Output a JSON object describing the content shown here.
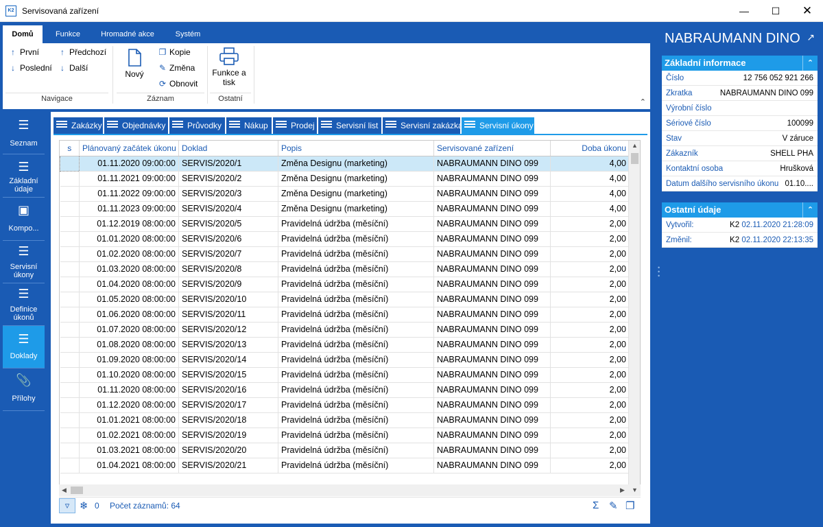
{
  "window": {
    "title": "Servisovaná zařízení",
    "icon_text": "K2"
  },
  "ribbon": {
    "tabs": [
      "Domů",
      "Funkce",
      "Hromadné akce",
      "Systém"
    ],
    "navigace": {
      "label": "Navigace",
      "prvni": "První",
      "predchozi": "Předchozí",
      "posledni": "Poslední",
      "dalsi": "Další"
    },
    "zaznam": {
      "label": "Záznam",
      "novy": "Nový",
      "kopie": "Kopie",
      "zmena": "Změna",
      "obnovit": "Obnovit"
    },
    "ostatni": {
      "label": "Ostatní",
      "funkce_line1": "Funkce a",
      "funkce_line2": "tisk"
    }
  },
  "leftnav": [
    {
      "label": "Seznam",
      "icon": "list-icon"
    },
    {
      "label": "Základní údaje",
      "icon": "details-list-icon"
    },
    {
      "label": "Kompo...",
      "icon": "box-icon"
    },
    {
      "label": "Servisní úkony",
      "icon": "list-icon"
    },
    {
      "label": "Definice úkonů",
      "icon": "list-icon"
    },
    {
      "label": "Doklady",
      "icon": "list-icon"
    },
    {
      "label": "Přílohy",
      "icon": "paperclip-icon"
    }
  ],
  "doc_tabs": [
    "Zakázky",
    "Objednávky",
    "Průvodky",
    "Nákup",
    "Prodej",
    "Servisní list",
    "Servisní zakázka",
    "Servisní úkony"
  ],
  "table": {
    "columns": [
      "s",
      "Plánovaný začátek úkonu",
      "Doklad",
      "Popis",
      "Servisované zařízení",
      "Doba úkonu"
    ],
    "rows": [
      [
        "",
        "01.11.2020 09:00:00",
        "SERVIS/2020/1",
        "Změna Designu (marketing)",
        "NABRAUMANN DINO 099",
        "4,00"
      ],
      [
        "",
        "01.11.2021 09:00:00",
        "SERVIS/2020/2",
        "Změna Designu (marketing)",
        "NABRAUMANN DINO 099",
        "4,00"
      ],
      [
        "",
        "01.11.2022 09:00:00",
        "SERVIS/2020/3",
        "Změna Designu (marketing)",
        "NABRAUMANN DINO 099",
        "4,00"
      ],
      [
        "",
        "01.11.2023 09:00:00",
        "SERVIS/2020/4",
        "Změna Designu (marketing)",
        "NABRAUMANN DINO 099",
        "4,00"
      ],
      [
        "",
        "01.12.2019 08:00:00",
        "SERVIS/2020/5",
        "Pravidelná údržba (měsíční)",
        "NABRAUMANN DINO 099",
        "2,00"
      ],
      [
        "",
        "01.01.2020 08:00:00",
        "SERVIS/2020/6",
        "Pravidelná údržba (měsíční)",
        "NABRAUMANN DINO 099",
        "2,00"
      ],
      [
        "",
        "01.02.2020 08:00:00",
        "SERVIS/2020/7",
        "Pravidelná údržba (měsíční)",
        "NABRAUMANN DINO 099",
        "2,00"
      ],
      [
        "",
        "01.03.2020 08:00:00",
        "SERVIS/2020/8",
        "Pravidelná údržba (měsíční)",
        "NABRAUMANN DINO 099",
        "2,00"
      ],
      [
        "",
        "01.04.2020 08:00:00",
        "SERVIS/2020/9",
        "Pravidelná údržba (měsíční)",
        "NABRAUMANN DINO 099",
        "2,00"
      ],
      [
        "",
        "01.05.2020 08:00:00",
        "SERVIS/2020/10",
        "Pravidelná údržba (měsíční)",
        "NABRAUMANN DINO 099",
        "2,00"
      ],
      [
        "",
        "01.06.2020 08:00:00",
        "SERVIS/2020/11",
        "Pravidelná údržba (měsíční)",
        "NABRAUMANN DINO 099",
        "2,00"
      ],
      [
        "",
        "01.07.2020 08:00:00",
        "SERVIS/2020/12",
        "Pravidelná údržba (měsíční)",
        "NABRAUMANN DINO 099",
        "2,00"
      ],
      [
        "",
        "01.08.2020 08:00:00",
        "SERVIS/2020/13",
        "Pravidelná údržba (měsíční)",
        "NABRAUMANN DINO 099",
        "2,00"
      ],
      [
        "",
        "01.09.2020 08:00:00",
        "SERVIS/2020/14",
        "Pravidelná údržba (měsíční)",
        "NABRAUMANN DINO 099",
        "2,00"
      ],
      [
        "",
        "01.10.2020 08:00:00",
        "SERVIS/2020/15",
        "Pravidelná údržba (měsíční)",
        "NABRAUMANN DINO 099",
        "2,00"
      ],
      [
        "",
        "01.11.2020 08:00:00",
        "SERVIS/2020/16",
        "Pravidelná údržba (měsíční)",
        "NABRAUMANN DINO 099",
        "2,00"
      ],
      [
        "",
        "01.12.2020 08:00:00",
        "SERVIS/2020/17",
        "Pravidelná údržba (měsíční)",
        "NABRAUMANN DINO 099",
        "2,00"
      ],
      [
        "",
        "01.01.2021 08:00:00",
        "SERVIS/2020/18",
        "Pravidelná údržba (měsíční)",
        "NABRAUMANN DINO 099",
        "2,00"
      ],
      [
        "",
        "01.02.2021 08:00:00",
        "SERVIS/2020/19",
        "Pravidelná údržba (měsíční)",
        "NABRAUMANN DINO 099",
        "2,00"
      ],
      [
        "",
        "01.03.2021 08:00:00",
        "SERVIS/2020/20",
        "Pravidelná údržba (měsíční)",
        "NABRAUMANN DINO 099",
        "2,00"
      ],
      [
        "",
        "01.04.2021 08:00:00",
        "SERVIS/2020/21",
        "Pravidelná údržba (měsíční)",
        "NABRAUMANN DINO 099",
        "2,00"
      ]
    ]
  },
  "statusbar": {
    "filter_count": "0",
    "record_count": "Počet záznamů: 64"
  },
  "rightpanel": {
    "title": "NABRAUMANN DINO",
    "basic": {
      "header": "Základní informace",
      "fields": [
        {
          "label": "Číslo",
          "value": "12 756 052 921 266"
        },
        {
          "label": "Zkratka",
          "value": "NABRAUMANN DINO 099"
        },
        {
          "label": "Výrobní číslo",
          "value": ""
        },
        {
          "label": "Sériové číslo",
          "value": "100099"
        },
        {
          "label": "Stav",
          "value": "V záruce"
        },
        {
          "label": "Zákazník",
          "value": "SHELL PHA"
        },
        {
          "label": "Kontaktní osoba",
          "value": "Hrušková"
        },
        {
          "label": "Datum dalšího servisního úkonu",
          "value": "01.10...."
        }
      ]
    },
    "other": {
      "header": "Ostatní údaje",
      "fields": [
        {
          "label": "Vytvořil:",
          "user": "K2",
          "value": "02.11.2020 21:28:09"
        },
        {
          "label": "Změnil:",
          "user": "K2",
          "value": "02.11.2020 22:13:35"
        }
      ]
    }
  },
  "colors": {
    "frame_blue": "#1a5bb4",
    "accent_blue": "#1e9be8",
    "selected_row": "#cce8f8"
  }
}
